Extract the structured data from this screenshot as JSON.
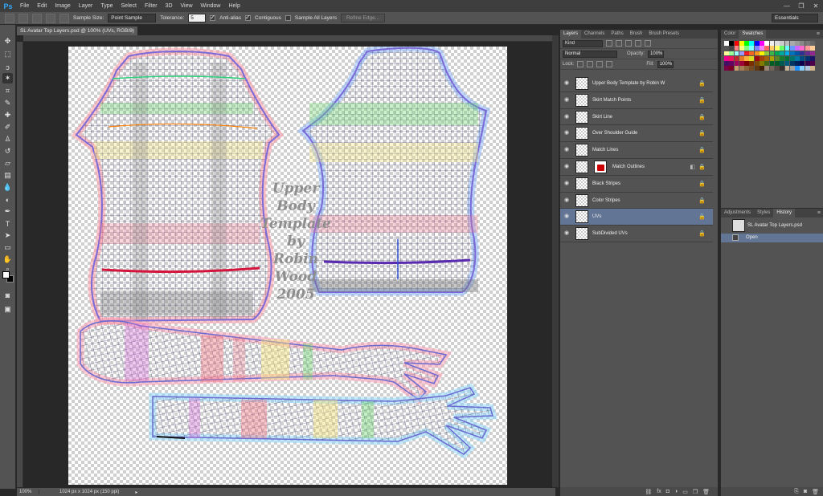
{
  "app": {
    "logo": "Ps"
  },
  "menu": [
    "File",
    "Edit",
    "Image",
    "Layer",
    "Type",
    "Select",
    "Filter",
    "3D",
    "View",
    "Window",
    "Help"
  ],
  "window_controls": [
    "—",
    "❐",
    "✕"
  ],
  "options": {
    "sample_size_label": "Sample Size:",
    "sample_size_value": "Point Sample",
    "tolerance_label": "Tolerance:",
    "tolerance_value": "5",
    "antialias_label": "Anti-alias",
    "contiguous_label": "Contiguous",
    "sample_all_label": "Sample All Layers",
    "refine_edge_label": "Refine Edge...",
    "workspace_value": "Essentials"
  },
  "document": {
    "tab_title": "SL Avatar Top Layers.psd @ 100% (UVs, RGB/8)",
    "tab_close": "×",
    "canvas_text": [
      "Upper",
      "Body",
      "Template",
      "by",
      "Robin",
      "Wood",
      "2005"
    ]
  },
  "status": {
    "zoom": "100%",
    "info": "1024 px x 1024 px (150 ppi)",
    "arrow": "▸"
  },
  "layers_panel": {
    "tabs": [
      "Layers",
      "Channels",
      "Paths",
      "Brush",
      "Brush Presets"
    ],
    "kind_value": "Kind",
    "blend_value": "Normal",
    "opacity_label": "Opacity:",
    "opacity_value": "100%",
    "lock_label": "Lock:",
    "fill_label": "Fill:",
    "fill_value": "100%",
    "layers": [
      {
        "name": "Upper Body Template by Robin W",
        "selected": false
      },
      {
        "name": "Skirt Match Points",
        "selected": false
      },
      {
        "name": "Skirt Line",
        "selected": false
      },
      {
        "name": "Over Shoulder Guide",
        "selected": false
      },
      {
        "name": "Match Lines",
        "selected": false
      },
      {
        "name": "Match Outlines",
        "selected": false
      },
      {
        "name": "Black Stripes",
        "selected": false
      },
      {
        "name": "Color Stripes",
        "selected": false
      },
      {
        "name": "UVs",
        "selected": true
      },
      {
        "name": "SubDivided UVs",
        "selected": false
      }
    ]
  },
  "color_panel": {
    "tabs": [
      "Color",
      "Swatches"
    ]
  },
  "history_panel": {
    "tabs": [
      "Adjustments",
      "Styles",
      "History"
    ],
    "snapshot": "SL Avatar Top Layers.psd",
    "states": [
      "Open"
    ]
  },
  "swatch_colors": [
    "#ffffff",
    "#000000",
    "#ff0000",
    "#ffff00",
    "#00ff00",
    "#00ffff",
    "#0000ff",
    "#ff00ff",
    "#ffffff",
    "#eeeeee",
    "#dddddd",
    "#cccccc",
    "#bbbbbb",
    "#aaaaaa",
    "#999999",
    "#888888",
    "#777777",
    "#666666",
    "#555555",
    "#444444",
    "#ff8080",
    "#ffff80",
    "#80ff80",
    "#80ffff",
    "#8080ff",
    "#ff80ff",
    "#ff6666",
    "#ffcc66",
    "#ffff66",
    "#66ff66",
    "#66ffff",
    "#6699ff",
    "#cc66ff",
    "#ff66cc",
    "#ff9999",
    "#ffcc99",
    "#ffff99",
    "#99ff99",
    "#99ffff",
    "#9999ff",
    "#ed1c24",
    "#f26522",
    "#f7941d",
    "#fff200",
    "#8dc63f",
    "#39b54a",
    "#00a651",
    "#00a99d",
    "#00aeef",
    "#0072bc",
    "#0054a6",
    "#2e3192",
    "#662d91",
    "#92278f",
    "#ec008c",
    "#ed145b",
    "#c1272d",
    "#e27826",
    "#fbb03b",
    "#d9e021",
    "#9e0b0f",
    "#a0410d",
    "#a36209",
    "#aba000",
    "#598527",
    "#1a7b30",
    "#007236",
    "#00746b",
    "#0076a3",
    "#004b80",
    "#003471",
    "#1b1464",
    "#440e62",
    "#630460",
    "#9e005d",
    "#9e0039",
    "#790000",
    "#7b2e00",
    "#7d4900",
    "#827b00",
    "#406618",
    "#005e20",
    "#005826",
    "#005952",
    "#005b7f",
    "#003663",
    "#002157",
    "#0d004c",
    "#32004b",
    "#4b0049",
    "#7b0046",
    "#7a0026",
    "#c69c6d",
    "#a67c52",
    "#8c6239",
    "#754c24",
    "#603913",
    "#42210b",
    "#998675",
    "#736357",
    "#534741",
    "#362f2d",
    "#c7b299",
    "#a0a0a0",
    "#1e90ff",
    "#87cefa",
    "#b0c4de",
    "#d2b48c"
  ]
}
